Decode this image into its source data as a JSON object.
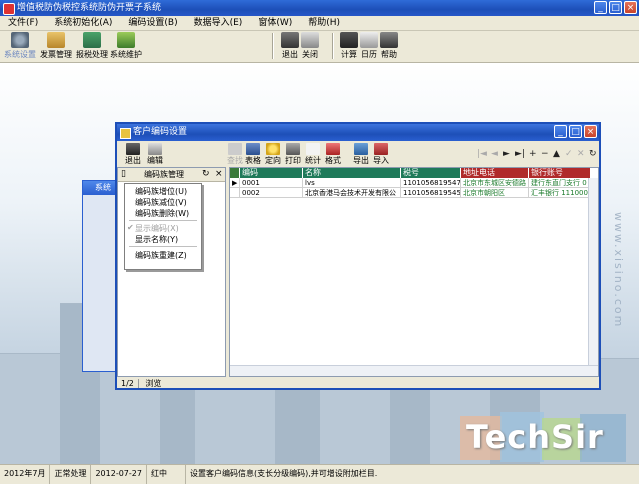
{
  "app": {
    "title": "增值税防伪税控系统防伪开票子系统",
    "window_buttons": [
      "_",
      "□",
      "×"
    ]
  },
  "menu": [
    {
      "label": "文件(F)"
    },
    {
      "label": "系统初始化(A)"
    },
    {
      "label": "编码设置(B)"
    },
    {
      "label": "数据导入(E)"
    },
    {
      "label": "窗体(W)"
    },
    {
      "label": "帮助(H)"
    }
  ],
  "main_toolbar": {
    "left": [
      "系统设置",
      "发票管理",
      "报税处理",
      "系统维护"
    ],
    "middle": [
      "退出",
      "关闭"
    ],
    "right": [
      "计算",
      "日历",
      "帮助"
    ]
  },
  "dialog": {
    "title": "客户编码设置",
    "window_buttons": [
      "_",
      "□",
      "×"
    ],
    "tools_left": [
      "退出",
      "编辑"
    ],
    "tools_main": [
      {
        "label": "查找",
        "disabled": true
      },
      {
        "label": "表格",
        "disabled": false
      },
      {
        "label": "定向",
        "disabled": false
      },
      {
        "label": "打印",
        "disabled": false
      },
      {
        "label": "统计",
        "disabled": false
      },
      {
        "label": "格式",
        "disabled": false
      }
    ],
    "tools_io": [
      "导出",
      "导入"
    ],
    "nav": {
      "first": "|◄",
      "prev": "◄",
      "next": "►",
      "last": "►|",
      "add": "+",
      "delete": "−",
      "up": "▲",
      "confirm": "✓",
      "cancel": "✕",
      "refresh": "↻"
    },
    "left_panel": {
      "title": "编码族管理",
      "refresh": "↻",
      "close": "×",
      "menu": [
        {
          "label": "编码族增位(U)",
          "disabled": false
        },
        {
          "label": "编码族减位(V)",
          "disabled": false
        },
        {
          "label": "编码族删除(W)",
          "disabled": false
        },
        {
          "label": "显示编码(X)",
          "disabled": true,
          "checked": true
        },
        {
          "label": "显示名称(Y)",
          "disabled": false
        },
        {
          "label": "编码族重建(Z)",
          "disabled": false
        }
      ]
    },
    "grid": {
      "columns": [
        {
          "label": "编码",
          "color": "#1f7a5a"
        },
        {
          "label": "名称",
          "color": "#1f7a5a"
        },
        {
          "label": "税号",
          "color": "#1f7a5a"
        },
        {
          "label": "地址电话",
          "color": "#b02a2a"
        },
        {
          "label": "银行账号",
          "color": "#b02a2a"
        }
      ],
      "rows": [
        {
          "code": "0001",
          "name": "lvs",
          "tax": "110105681954777",
          "addr": "北京市东城区安德路",
          "bank": "建行东直门支行 0"
        },
        {
          "code": "0002",
          "name": "北京香港马会技术开发有限公",
          "tax": "110105681954555",
          "addr": "北京市朝阳区",
          "bank": "汇丰银行 111000"
        }
      ]
    },
    "status": {
      "page": "1/2",
      "mode": "浏览"
    }
  },
  "status_bar": {
    "month": "2012年7月",
    "state": "正常处理",
    "date": "2012-07-27",
    "tag": "红中",
    "message": "设置客户编码信息(支长分级编码),并可增设附加栏目."
  },
  "background_window": {
    "title": "系统"
  },
  "watermark": {
    "side": "www.xisino.com",
    "logo": "TechSir"
  }
}
